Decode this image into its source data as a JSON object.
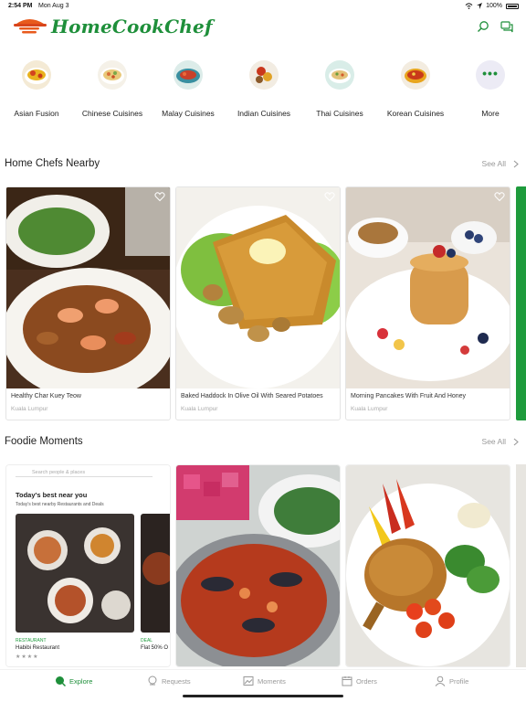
{
  "status": {
    "time": "2:54 PM",
    "date": "Mon Aug 3",
    "battery": "100%"
  },
  "app": {
    "name": "HomeCookChef",
    "brand_color": "#1e8f3a"
  },
  "header_icons": [
    "search-icon",
    "chat-icon"
  ],
  "cuisines": [
    {
      "label": "Asian Fusion",
      "icon": "asian-fusion-icon"
    },
    {
      "label": "Chinese Cuisines",
      "icon": "chinese-cuisine-icon"
    },
    {
      "label": "Malay Cuisines",
      "icon": "malay-cuisine-icon"
    },
    {
      "label": "Indian Cuisines",
      "icon": "indian-cuisine-icon"
    },
    {
      "label": "Thai Cuisines",
      "icon": "thai-cuisine-icon"
    },
    {
      "label": "Korean Cuisines",
      "icon": "korean-cuisine-icon"
    },
    {
      "label": "More",
      "icon": "more-icon"
    }
  ],
  "chefs_nearby": {
    "title": "Home Chefs Nearby",
    "see_all": "See All",
    "cards": [
      {
        "caption": "Healthy Char Kuey Teow",
        "location": "Kuala Lumpur"
      },
      {
        "caption": "Baked Haddock In Olive Oil With Seared Potatoes",
        "location": "Kuala Lumpur"
      },
      {
        "caption": "Morning Pancakes With Fruit And Honey",
        "location": "Kuala Lumpur"
      }
    ]
  },
  "foodie_moments": {
    "title": "Foodie Moments",
    "see_all": "See All",
    "phone_screen": {
      "search_placeholder": "Search people & places",
      "heading": "Today's best near you",
      "subheading": "Today's best nearby Restaurants and Deals",
      "tag1": "RESTAURANT",
      "name1": "Habibi Restaurant",
      "tag2": "DEAL",
      "name2": "Flat 50% O",
      "stars": "★★★★"
    }
  },
  "tabs": [
    {
      "label": "Explore",
      "icon": "explore-icon",
      "active": true
    },
    {
      "label": "Requests",
      "icon": "requests-icon",
      "active": false
    },
    {
      "label": "Moments",
      "icon": "moments-icon",
      "active": false
    },
    {
      "label": "Orders",
      "icon": "orders-icon",
      "active": false
    },
    {
      "label": "Profile",
      "icon": "profile-icon",
      "active": false
    }
  ]
}
